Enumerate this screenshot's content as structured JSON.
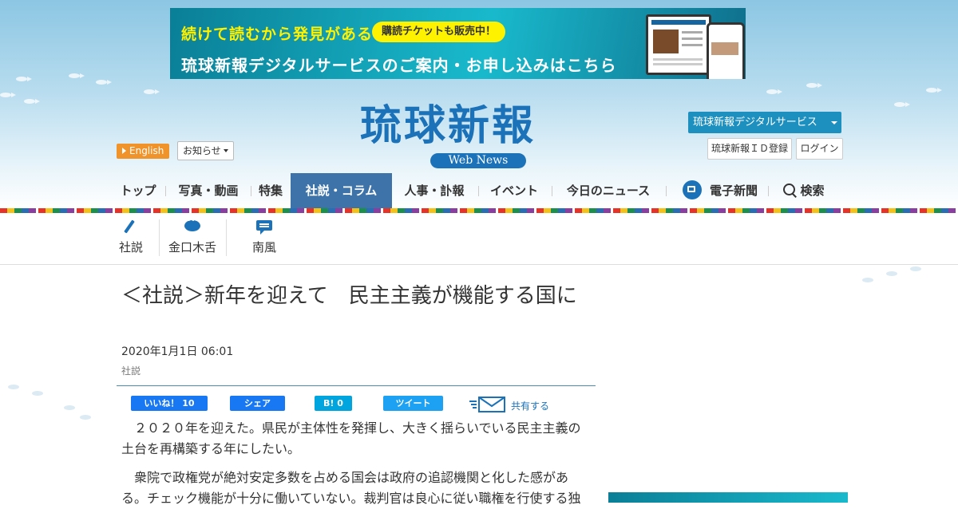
{
  "banner": {
    "line1": "続けて読むから発見がある",
    "pill": "購読チケットも販売中！",
    "line2": "琉球新報デジタルサービスのご案内・お申し込みはこちら"
  },
  "header": {
    "logo": "琉球新報",
    "logo_sub": "Web News",
    "english": "English",
    "notice": "お知らせ",
    "digital_service": "琉球新報デジタルサービス",
    "id_register": "琉球新報ＩＤ登録",
    "login": "ログイン"
  },
  "nav": {
    "items": [
      "トップ",
      "写真・動画",
      "特集",
      "社説・コラム",
      "人事・訃報",
      "イベント",
      "今日のニュース",
      "電子新聞",
      "検索"
    ],
    "active": "社説・コラム"
  },
  "subnav": {
    "items": [
      {
        "label": "社説",
        "icon": "pen-icon"
      },
      {
        "label": "金口木舌",
        "icon": "speech-bubble-icon"
      },
      {
        "label": "南風",
        "icon": "message-icon"
      }
    ]
  },
  "article": {
    "title": "＜社説＞新年を迎えて　民主主義が機能する国に",
    "date": "2020年1月1日 06:01",
    "category": "社説",
    "paragraphs": [
      "２０２０年を迎えた。県民が主体性を発揮し、大きく揺らいでいる民主主義の土台を再構築する年にしたい。",
      "衆院で政権党が絶対安定多数を占める国会は政府の追認機関と化した感がある。チェック機能が十分に働いていない。裁判官は良心に従い職権を行使する独"
    ]
  },
  "share": {
    "like": "いいね！ 10",
    "facebook": "シェア",
    "hatena": "B! 0",
    "tweet": "ツイート",
    "share_label": "共有する"
  },
  "colors": {
    "brand": "#1b72b9",
    "nav_active": "#3e73a9",
    "english": "#f0932b",
    "digital": "#1e90c0",
    "facebook": "#1877f2",
    "hatena": "#00a4de",
    "twitter": "#1da1f2"
  }
}
